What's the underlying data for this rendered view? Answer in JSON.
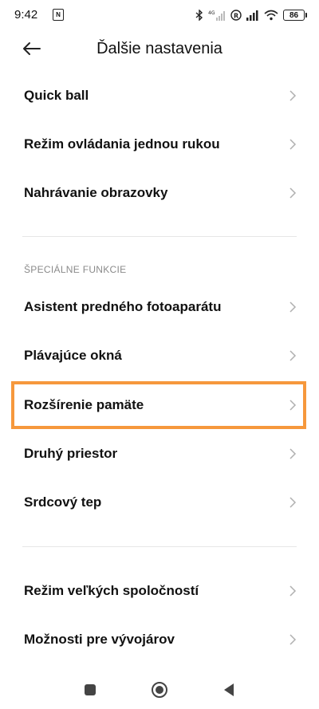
{
  "status_bar": {
    "time": "9:42",
    "battery": "86",
    "network_label": "4G"
  },
  "header": {
    "title": "Ďalšie nastavenia"
  },
  "items_top": [
    {
      "label": "Quick ball"
    },
    {
      "label": "Režim ovládania jednou rukou"
    },
    {
      "label": "Nahrávanie obrazovky"
    }
  ],
  "section": {
    "title": "ŠPECIÁLNE FUNKCIE"
  },
  "items_special": [
    {
      "label": "Asistent predného fotoaparátu"
    },
    {
      "label": "Plávajúce okná"
    },
    {
      "label": "Rozšírenie pamäte"
    },
    {
      "label": "Druhý priestor"
    },
    {
      "label": "Srdcový tep"
    }
  ],
  "items_bottom": [
    {
      "label": "Režim veľkých spoločností"
    },
    {
      "label": "Možnosti pre vývojárov"
    }
  ],
  "colors": {
    "highlight": "#f6983c",
    "text": "#111111",
    "section_header": "#8a8a8a",
    "chevron": "#b0b0b0"
  }
}
